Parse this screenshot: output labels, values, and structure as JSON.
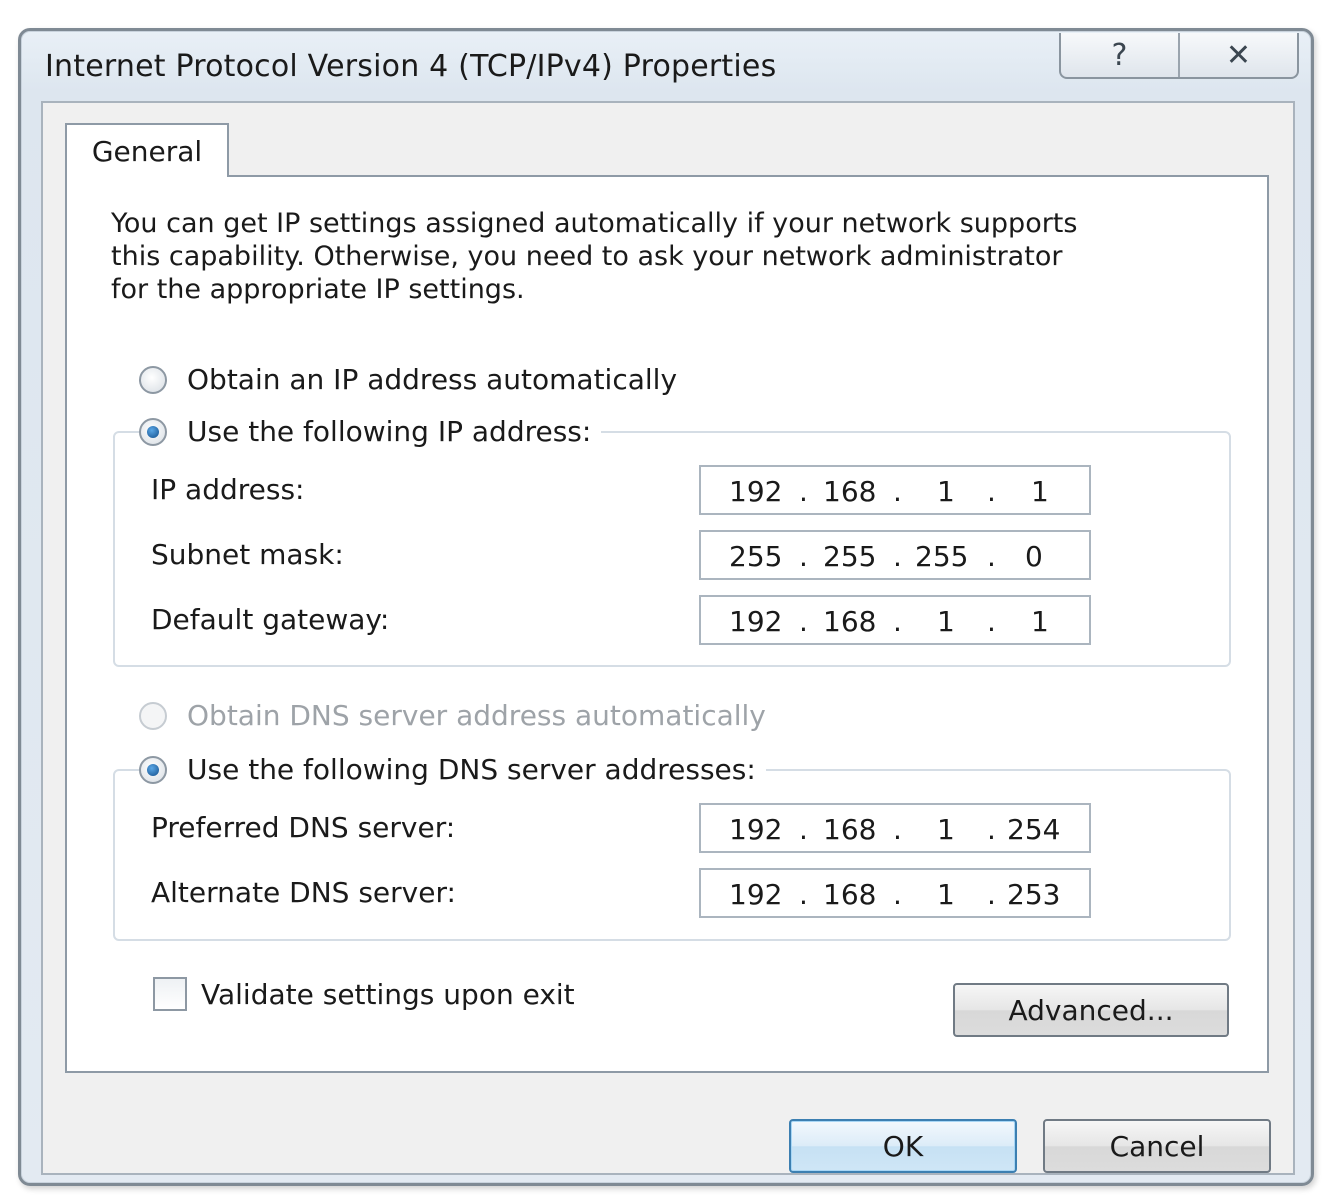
{
  "window": {
    "title": "Internet Protocol Version 4 (TCP/IPv4) Properties",
    "help_icon": "help-icon",
    "close_icon": "close-icon"
  },
  "tabs": [
    {
      "label": "General",
      "selected": true
    }
  ],
  "general": {
    "intro": "You can get IP settings assigned automatically if your network supports\nthis capability. Otherwise, you need to ask your network administrator\nfor the appropriate IP settings.",
    "ip_mode": {
      "auto_label": "Obtain an IP address automatically",
      "manual_label": "Use the following IP address:",
      "selected": "manual"
    },
    "ip_fields": [
      {
        "label": "IP address:",
        "octets": [
          "192",
          "168",
          "1",
          "1"
        ]
      },
      {
        "label": "Subnet mask:",
        "octets": [
          "255",
          "255",
          "255",
          "0"
        ]
      },
      {
        "label": "Default gateway:",
        "octets": [
          "192",
          "168",
          "1",
          "1"
        ]
      }
    ],
    "dns_mode": {
      "auto_label": "Obtain DNS server address automatically",
      "auto_enabled": false,
      "manual_label": "Use the following DNS server addresses:",
      "selected": "manual"
    },
    "dns_fields": [
      {
        "label": "Preferred DNS server:",
        "octets": [
          "192",
          "168",
          "1",
          "254"
        ]
      },
      {
        "label": "Alternate DNS server:",
        "octets": [
          "192",
          "168",
          "1",
          "253"
        ]
      }
    ],
    "validate": {
      "label": "Validate settings upon exit",
      "checked": false
    },
    "advanced_label": "Advanced..."
  },
  "footer": {
    "ok_label": "OK",
    "cancel_label": "Cancel"
  }
}
